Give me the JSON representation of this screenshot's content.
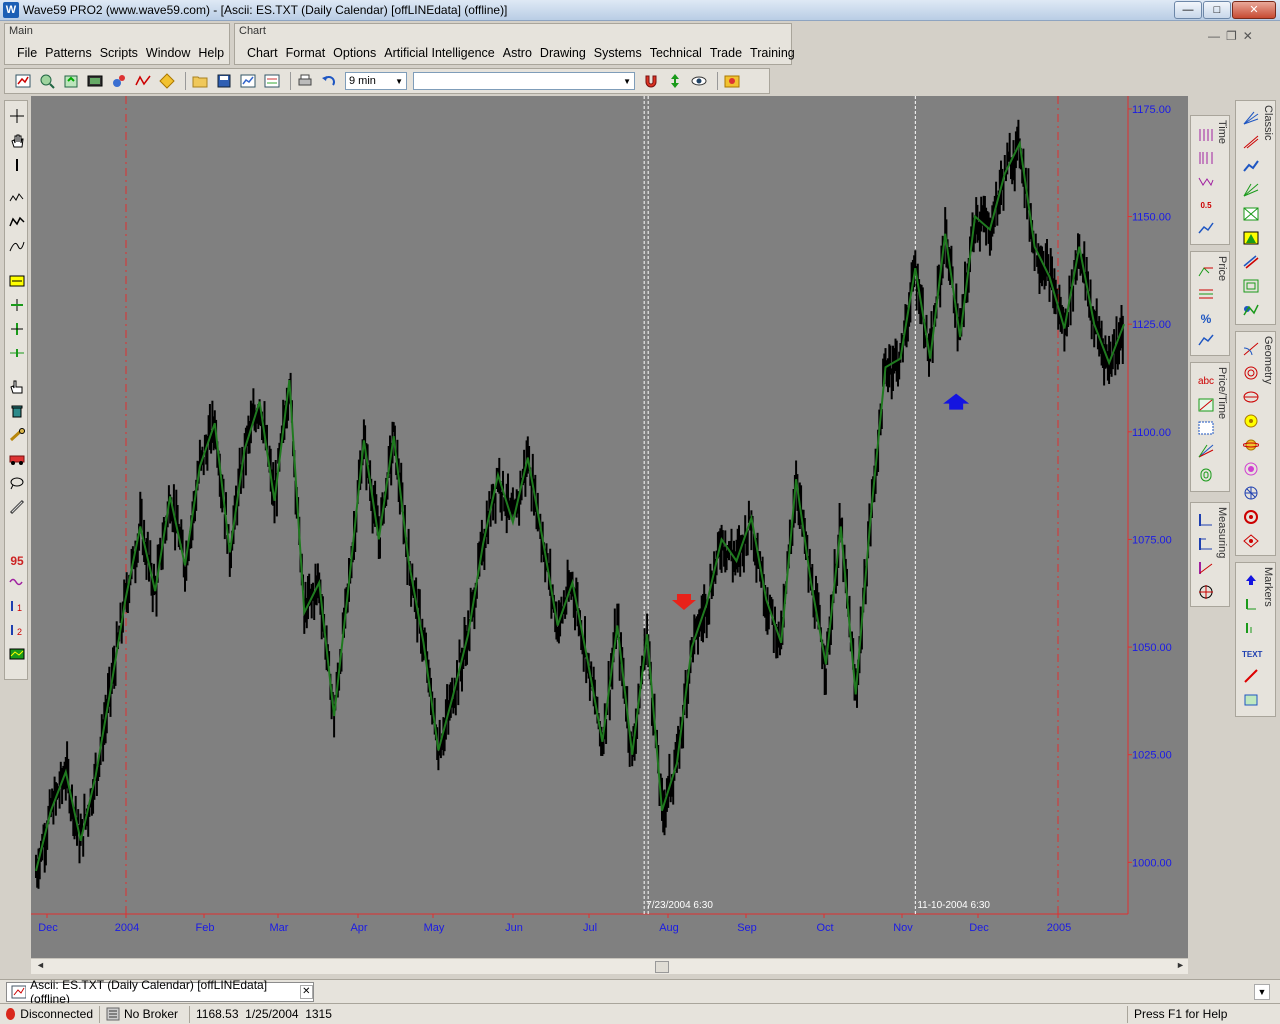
{
  "window": {
    "title": "Wave59 PRO2 (www.wave59.com) - [Ascii: ES.TXT (Daily Calendar) [offLINEdata] (offline)]",
    "app_icon": "W",
    "minimize": "—",
    "maximize": "□",
    "close": "✕"
  },
  "main_band": {
    "label": "Main",
    "menu": [
      "File",
      "Patterns",
      "Scripts",
      "Window",
      "Help"
    ]
  },
  "chart_band": {
    "label": "Chart",
    "menu": [
      "Chart",
      "Format",
      "Options",
      "Artificial Intelligence",
      "Astro",
      "Drawing",
      "Systems",
      "Technical",
      "Trade",
      "Training"
    ]
  },
  "mdi": {
    "minimize": "—",
    "restore": "❐",
    "close": "✕"
  },
  "toolbar": {
    "interval_value": "9 min",
    "symbol_value": "",
    "dropdown_arrow": "▼"
  },
  "chart_data": {
    "type": "line",
    "background": "#808080",
    "ylim": [
      988,
      1178
    ],
    "y_ticks": [
      1175,
      1150,
      1125,
      1100,
      1075,
      1050,
      1025,
      1000
    ],
    "y_tick_labels": [
      "1175.00",
      "1150.00",
      "1125.00",
      "1100.00",
      "1075.00",
      "1050.00",
      "1025.00",
      "1000.00"
    ],
    "x_tick_labels": [
      {
        "label": "Dec",
        "major": false
      },
      {
        "label": "2004",
        "major": true
      },
      {
        "label": "Feb",
        "major": false
      },
      {
        "label": "Mar",
        "major": false
      },
      {
        "label": "Apr",
        "major": false
      },
      {
        "label": "May",
        "major": false
      },
      {
        "label": "Jun",
        "major": false
      },
      {
        "label": "Jul",
        "major": false
      },
      {
        "label": "Aug",
        "major": false
      },
      {
        "label": "Sep",
        "major": false
      },
      {
        "label": "Oct",
        "major": false
      },
      {
        "label": "Nov",
        "major": false
      },
      {
        "label": "Dec",
        "major": false
      },
      {
        "label": "2005",
        "major": true
      }
    ],
    "series": [
      {
        "color": "#1f7a1f",
        "values": [
          998,
          1012,
          1021,
          1005,
          1020,
          1040,
          1061,
          1078,
          1063,
          1085,
          1069,
          1092,
          1102,
          1072,
          1096,
          1107,
          1084,
          1112,
          1058,
          1065,
          1034,
          1065,
          1098,
          1075,
          1099,
          1070,
          1051,
          1026,
          1039,
          1053,
          1074,
          1090,
          1079,
          1094,
          1075,
          1055,
          1065,
          1047,
          1028,
          1055,
          1025,
          1053,
          1012,
          1023,
          1050,
          1060,
          1075,
          1070,
          1080,
          1061,
          1051,
          1089,
          1065,
          1046,
          1078,
          1039,
          1080,
          1115,
          1117,
          1138,
          1117,
          1146,
          1122,
          1150,
          1147,
          1160,
          1167,
          1143,
          1136,
          1124,
          1143,
          1125,
          1116,
          1125
        ]
      }
    ],
    "bars": {
      "color": "#000000",
      "note": "OHLC bars rendered around the series path"
    },
    "markers": [
      {
        "type": "arrow-down",
        "color": "#e8221a",
        "x_index": 42,
        "price": 1060
      },
      {
        "type": "arrow-up",
        "color": "#1414e0",
        "x_index": 61,
        "price": 1107
      }
    ],
    "vertical_lines": [
      {
        "label": "7/23/2004 6:30",
        "x_index": 40
      },
      {
        "label": "11-10-2004 6:30",
        "x_index": 59
      }
    ],
    "year_dividers": [
      2004,
      2005
    ]
  },
  "scrollbar": {
    "left": "◄",
    "right": "►"
  },
  "tabbar": {
    "tab_label": "Ascii: ES.TXT (Daily Calendar) [offLINEdata] (offline)",
    "tab_close": "✕",
    "dropdown": "▼"
  },
  "statusbar": {
    "connection": "Disconnected",
    "broker": "No Broker",
    "readout": "1168.53  1/25/2004  1315",
    "help": "Press F1 for Help"
  },
  "right_panels": [
    {
      "label": "Time"
    },
    {
      "label": "Price"
    },
    {
      "label": "Price/Time"
    },
    {
      "label": "Measuring"
    },
    {
      "label": "Classic"
    },
    {
      "label": "Geometry"
    },
    {
      "label": "Markers"
    }
  ],
  "right_glyphs": {
    "text_tool": "TEXT",
    "abc_tool": "abc",
    "pct_tool": "%",
    "fib_tool": "0.5"
  }
}
